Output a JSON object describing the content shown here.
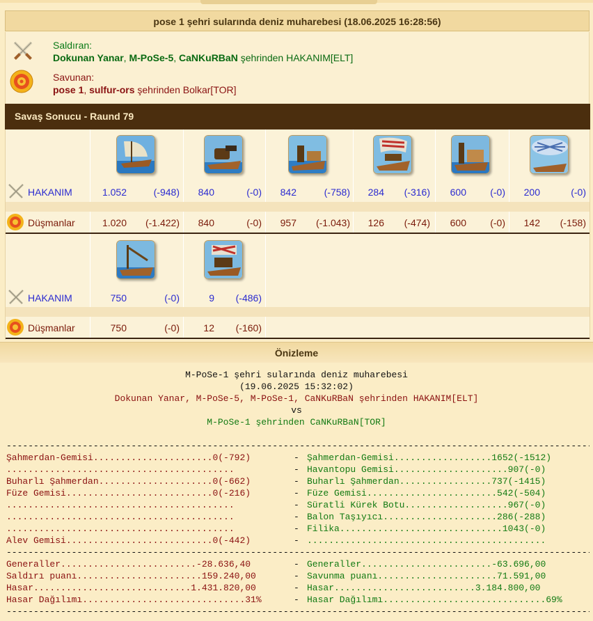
{
  "header": {
    "title": "pose 1 şehri sularında deniz muharebesi (18.06.2025 16:28:56)"
  },
  "attacker": {
    "label": "Saldıran:",
    "names": [
      "Dokunan Yanar",
      "M-PoSe-5",
      "CaNKuRBaN"
    ],
    "suffix": "şehrinden HAKANIM[ELT]"
  },
  "defender": {
    "label": "Savunan:",
    "names": [
      "pose 1",
      "sulfur-ors"
    ],
    "suffix": "şehrinden Bolkar[TOR]"
  },
  "round": {
    "title": "Savaş Sonucu - Raund 79"
  },
  "battle": {
    "row1": {
      "attacker_label": "HAKANIM",
      "defender_label": "Düşmanlar",
      "units": [
        {
          "icon": "ram-ship-icon",
          "att": "1.052",
          "att_loss": "(-948)",
          "def": "1.020",
          "def_loss": "(-1.422)"
        },
        {
          "icon": "mortar-ship-icon",
          "att": "840",
          "att_loss": "(-0)",
          "def": "840",
          "def_loss": "(-0)"
        },
        {
          "icon": "steam-ram-icon",
          "att": "842",
          "att_loss": "(-758)",
          "def": "957",
          "def_loss": "(-1.043)"
        },
        {
          "icon": "rocket-ship-icon",
          "att": "284",
          "att_loss": "(-316)",
          "def": "126",
          "def_loss": "(-474)"
        },
        {
          "icon": "paddle-speedboat-icon",
          "att": "600",
          "att_loss": "(-0)",
          "def": "600",
          "def_loss": "(-0)"
        },
        {
          "icon": "balloon-carrier-icon",
          "att": "200",
          "att_loss": "(-0)",
          "def": "142",
          "def_loss": "(-158)"
        }
      ]
    },
    "row2": {
      "attacker_label": "HAKANIM",
      "defender_label": "Düşmanlar",
      "units": [
        {
          "icon": "tender-ship-icon",
          "att": "750",
          "att_loss": "(-0)",
          "def": "750",
          "def_loss": "(-0)"
        },
        {
          "icon": "flamethrower-ship-icon",
          "att": "9",
          "att_loss": "(-486)",
          "def": "12",
          "def_loss": "(-160)"
        }
      ]
    }
  },
  "preview": {
    "heading": "Önizleme",
    "line1": "M-PoSe-1 şehri sularında deniz muharebesi",
    "line2": "(19.06.2025 15:32:02)",
    "line3": "Dokunan Yanar, M-PoSe-5, M-PoSe-1, CaNKuRBaN şehrinden HAKANIM[ELT]",
    "line4": "vs",
    "line5": "M-PoSe-1 şehrinden CaNKuRBaN[TOR]",
    "rule": "-------------------------------------------------------------------------------------------------------------------",
    "rows": [
      {
        "left": "Şahmerdan-Gemisi......................0(-792)",
        "right": "Şahmerdan-Gemisi..................1652(-1512)"
      },
      {
        "left": ".......................................... ",
        "right": "Havantopu Gemisi.....................907(-0)"
      },
      {
        "left": "Buharlı Şahmerdan.....................0(-662)",
        "right": "Buharlı Şahmerdan.................737(-1415)"
      },
      {
        "left": "Füze Gemisi...........................0(-216)",
        "right": "Füze Gemisi........................542(-504)"
      },
      {
        "left": ".......................................... ",
        "right": "Süratli Kürek Botu...................967(-0)"
      },
      {
        "left": ".......................................... ",
        "right": "Balon Taşıyıcı.....................286(-288)"
      },
      {
        "left": ".......................................... ",
        "right": "Filika..............................1043(-0)"
      },
      {
        "left": "Alev Gemisi...........................0(-442)",
        "right": "............................................"
      }
    ],
    "totals": [
      {
        "left": "Generaller.........................-28.636,40",
        "right": "Generaller........................-63.696,00"
      },
      {
        "left": "Saldırı puanı.......................159.240,00",
        "right": "Savunma puanı......................71.591,00"
      },
      {
        "left": "Hasar.............................1.431.820,00",
        "right": "Hasar..........................3.184.800,00"
      },
      {
        "left": "Hasar Dağılımı..............................31%",
        "right": "Hasar Dağılımı..............................69%"
      }
    ],
    "dash": "-"
  }
}
